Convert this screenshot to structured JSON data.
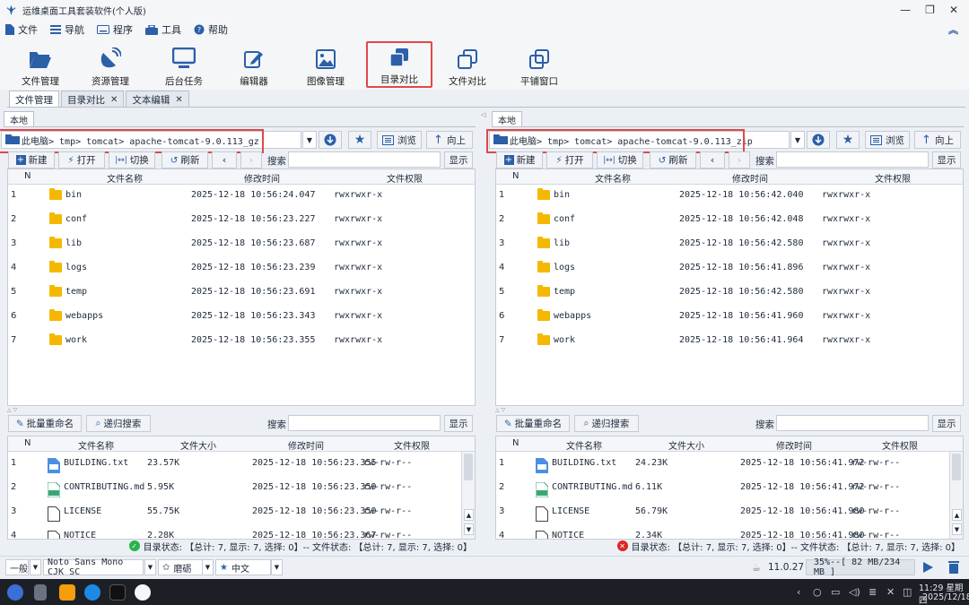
{
  "app": {
    "title": "运维桌面工具套装软件(个人版)"
  },
  "menu": [
    {
      "label": "文件",
      "icon": "file-icon"
    },
    {
      "label": "导航",
      "icon": "list-icon"
    },
    {
      "label": "程序",
      "icon": "keyboard-icon"
    },
    {
      "label": "工具",
      "icon": "toolbox-icon"
    },
    {
      "label": "帮助",
      "icon": "help-icon"
    }
  ],
  "toolbar": [
    {
      "label": "文件管理",
      "icon": "folder-open-icon"
    },
    {
      "label": "资源管理",
      "icon": "satellite-icon"
    },
    {
      "label": "后台任务",
      "icon": "monitor-icon"
    },
    {
      "label": "编辑器",
      "icon": "edit-icon"
    },
    {
      "label": "图像管理",
      "icon": "image-icon"
    },
    {
      "label": "目录对比",
      "icon": "layers-icon",
      "highlighted": true
    },
    {
      "label": "文件对比",
      "icon": "copy-icon"
    },
    {
      "label": "平铺窗口",
      "icon": "windows-icon"
    }
  ],
  "tabs": [
    {
      "label": "文件管理",
      "closable": false,
      "active": true
    },
    {
      "label": "目录对比",
      "closable": true
    },
    {
      "label": "文本编辑",
      "closable": true
    }
  ],
  "common": {
    "local_tab": "本地",
    "browse": "浏览",
    "up": "向上",
    "new": "新建",
    "open": "打开",
    "switch": "切换",
    "refresh": "刷新",
    "search": "搜索",
    "show": "显示",
    "batch_rename": "批量重命名",
    "recursive_search": "递归搜索",
    "col_n": "N",
    "col_name": "文件名称",
    "col_mtime": "修改时间",
    "col_perm": "文件权限",
    "col_size": "文件大小"
  },
  "left": {
    "path": "此电脑> tmp> tomcat> apache-tomcat-9.0.113_gz",
    "dirs": [
      {
        "n": "1",
        "name": "bin",
        "mtime": "2025-12-18 10:56:24.047",
        "perm": "rwxrwxr-x"
      },
      {
        "n": "2",
        "name": "conf",
        "mtime": "2025-12-18 10:56:23.227",
        "perm": "rwxrwxr-x"
      },
      {
        "n": "3",
        "name": "lib",
        "mtime": "2025-12-18 10:56:23.687",
        "perm": "rwxrwxr-x"
      },
      {
        "n": "4",
        "name": "logs",
        "mtime": "2025-12-18 10:56:23.239",
        "perm": "rwxrwxr-x"
      },
      {
        "n": "5",
        "name": "temp",
        "mtime": "2025-12-18 10:56:23.691",
        "perm": "rwxrwxr-x"
      },
      {
        "n": "6",
        "name": "webapps",
        "mtime": "2025-12-18 10:56:23.343",
        "perm": "rwxrwxr-x"
      },
      {
        "n": "7",
        "name": "work",
        "mtime": "2025-12-18 10:56:23.355",
        "perm": "rwxrwxr-x"
      }
    ],
    "files": [
      {
        "n": "1",
        "name": "BUILDING.txt",
        "size": "23.57K",
        "mtime": "2025-12-18 10:56:23.355",
        "perm": "rw-rw-r--"
      },
      {
        "n": "2",
        "name": "CONTRIBUTING.md",
        "size": "5.95K",
        "mtime": "2025-12-18 10:56:23.359",
        "perm": "rw-rw-r--"
      },
      {
        "n": "3",
        "name": "LICENSE",
        "size": "55.75K",
        "mtime": "2025-12-18 10:56:23.359",
        "perm": "rw-rw-r--"
      },
      {
        "n": "4",
        "name": "NOTICE",
        "size": "2.28K",
        "mtime": "2025-12-18 10:56:23.367",
        "perm": "rw-rw-r--"
      }
    ],
    "status": "目录状态: 【总计: 7, 显示: 7, 选择: 0】-- 文件状态: 【总计: 7, 显示: 7, 选择: 0】",
    "status_ok": true
  },
  "right": {
    "path": "此电脑> tmp> tomcat> apache-tomcat-9.0.113_zip",
    "dirs": [
      {
        "n": "1",
        "name": "bin",
        "mtime": "2025-12-18 10:56:42.040",
        "perm": "rwxrwxr-x"
      },
      {
        "n": "2",
        "name": "conf",
        "mtime": "2025-12-18 10:56:42.048",
        "perm": "rwxrwxr-x"
      },
      {
        "n": "3",
        "name": "lib",
        "mtime": "2025-12-18 10:56:42.580",
        "perm": "rwxrwxr-x"
      },
      {
        "n": "4",
        "name": "logs",
        "mtime": "2025-12-18 10:56:41.896",
        "perm": "rwxrwxr-x"
      },
      {
        "n": "5",
        "name": "temp",
        "mtime": "2025-12-18 10:56:42.580",
        "perm": "rwxrwxr-x"
      },
      {
        "n": "6",
        "name": "webapps",
        "mtime": "2025-12-18 10:56:41.960",
        "perm": "rwxrwxr-x"
      },
      {
        "n": "7",
        "name": "work",
        "mtime": "2025-12-18 10:56:41.964",
        "perm": "rwxrwxr-x"
      }
    ],
    "files": [
      {
        "n": "1",
        "name": "BUILDING.txt",
        "size": "24.23K",
        "mtime": "2025-12-18 10:56:41.972",
        "perm": "rw-rw-r--"
      },
      {
        "n": "2",
        "name": "CONTRIBUTING.md",
        "size": "6.11K",
        "mtime": "2025-12-18 10:56:41.972",
        "perm": "rw-rw-r--"
      },
      {
        "n": "3",
        "name": "LICENSE",
        "size": "56.79K",
        "mtime": "2025-12-18 10:56:41.980",
        "perm": "rw-rw-r--"
      },
      {
        "n": "4",
        "name": "NOTICE",
        "size": "2.34K",
        "mtime": "2025-12-18 10:56:41.980",
        "perm": "rw-rw-r--"
      }
    ],
    "status": "目录状态: 【总计: 7, 显示: 7, 选择: 0】-- 文件状态: 【总计: 7, 显示: 7, 选择: 0】",
    "status_ok": false
  },
  "bottom": {
    "style": "一般",
    "font": "Noto Sans Mono CJK SC",
    "theme": "磨砺",
    "lang": "中文",
    "java_version": "11.0.27",
    "memory": "35%--[ 82 MB/234 MB ]"
  },
  "taskbar": {
    "time": "11:29 星期四",
    "date": "2025/12/18"
  },
  "colors": {
    "accent": "#2b5fa8",
    "highlight": "#e04848",
    "folder": "#f5b800",
    "ok": "#27b34a",
    "err": "#e02424"
  }
}
